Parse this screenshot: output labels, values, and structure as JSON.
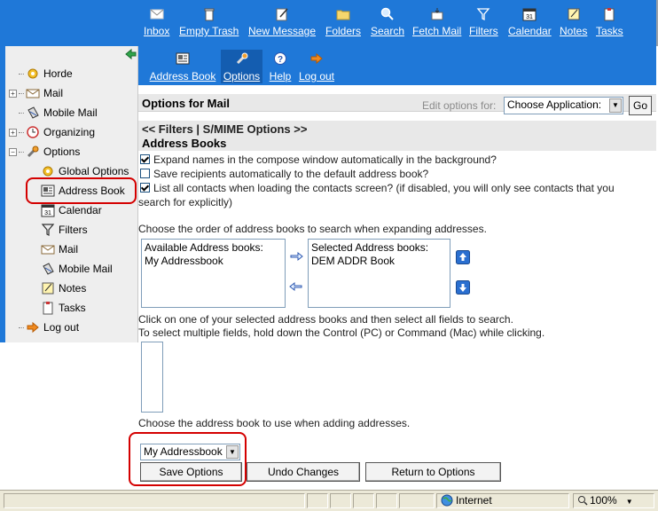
{
  "topbar": {
    "items": [
      {
        "label": "Inbox",
        "icon": "inbox-icon"
      },
      {
        "label": "Empty Trash",
        "icon": "trash-icon"
      },
      {
        "label": "New Message",
        "icon": "new-message-icon"
      },
      {
        "label": "Folders",
        "icon": "folder-icon"
      },
      {
        "label": "Search",
        "icon": "search-icon"
      },
      {
        "label": "Fetch Mail",
        "icon": "fetch-mail-icon"
      },
      {
        "label": "Filters",
        "icon": "filter-icon"
      },
      {
        "label": "Calendar",
        "icon": "calendar-icon"
      },
      {
        "label": "Notes",
        "icon": "notes-icon"
      },
      {
        "label": "Tasks",
        "icon": "tasks-icon"
      }
    ]
  },
  "optbar": {
    "items": [
      {
        "label": "Address Book",
        "icon": "address-book-icon"
      },
      {
        "label": "Options",
        "icon": "options-icon"
      },
      {
        "label": "Help",
        "icon": "help-icon"
      },
      {
        "label": "Log out",
        "icon": "logout-icon"
      }
    ]
  },
  "sidebar": {
    "items": [
      {
        "label": "Horde",
        "icon": "horde-icon"
      },
      {
        "label": "Mail",
        "icon": "mail-icon"
      },
      {
        "label": "Mobile Mail",
        "icon": "mobile-mail-icon"
      },
      {
        "label": "Organizing",
        "icon": "organizing-icon"
      },
      {
        "label": "Options",
        "icon": "options-icon"
      },
      {
        "label": "Global Options",
        "icon": "global-options-icon"
      },
      {
        "label": "Address Book",
        "icon": "address-book-icon"
      },
      {
        "label": "Calendar",
        "icon": "calendar-icon"
      },
      {
        "label": "Filters",
        "icon": "filter-icon"
      },
      {
        "label": "Mail",
        "icon": "mail-icon"
      },
      {
        "label": "Mobile Mail",
        "icon": "mobile-mail-icon"
      },
      {
        "label": "Notes",
        "icon": "notes-icon"
      },
      {
        "label": "Tasks",
        "icon": "tasks-icon"
      },
      {
        "label": "Log out",
        "icon": "logout-icon"
      }
    ]
  },
  "main": {
    "title": "Options for Mail",
    "edit_for_label": "Edit options for:",
    "app_select_value": "Choose Application:",
    "go_label": "Go",
    "nav_text": "<< Filters | S/MIME Options >>",
    "section_title": "Address Books",
    "checkbox1": "Expand names in the compose window automatically in the background?",
    "checkbox2": "Save recipients automatically to the default address book?",
    "checkbox3_line1": "List all contacts when loading the contacts screen? (if disabled, you will only see contacts that you",
    "checkbox3_line2": "search for explicitly)",
    "order_label": "Choose the order of address books to search when expanding addresses.",
    "available_header": "Available Address books:",
    "available_item": "My Addressbook",
    "selected_header": "Selected Address books:",
    "selected_item": "DEM ADDR Book",
    "fields_line1": "Click on one of your selected address books and then select all fields to search.",
    "fields_line2": "To select multiple fields, hold down the Control (PC) or Command (Mac) while clicking.",
    "adding_label": "Choose the address book to use when adding addresses.",
    "add_select_value": "My Addressbook",
    "save_label": "Save Options",
    "undo_label": "Undo Changes",
    "return_label": "Return to Options"
  },
  "statusbar": {
    "zone": "Internet",
    "zoom": "100%"
  },
  "colors": {
    "toolbar_blue": "#1f78d8",
    "highlight_red": "#d40000"
  }
}
